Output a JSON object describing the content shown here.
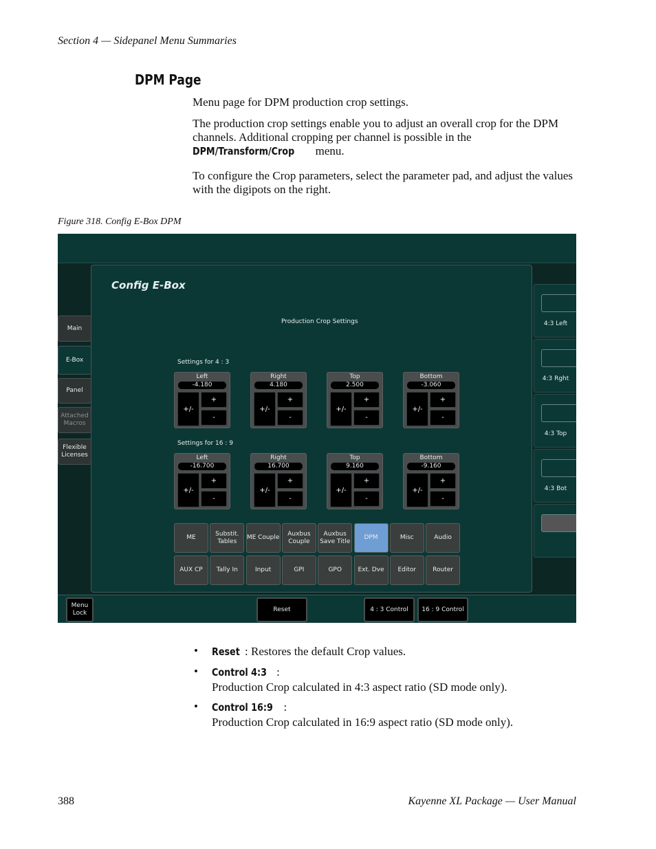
{
  "header": "Section 4 — Sidepanel Menu Summaries",
  "heading": "DPM Page",
  "para1": "Menu page for DPM production crop settings.",
  "para2a": "The production crop settings enable you to adjust an overall crop for the DPM channels. Additional cropping per channel is possible in the ",
  "para2b": "DPM/Transform/Crop",
  "para2c": " menu.",
  "para3": "To configure the Crop parameters, select the parameter pad, and adjust the values with the digipots on the right.",
  "caption": "Figure 318.  Config E-Box DPM",
  "ui": {
    "title": "Config E-Box",
    "section_title": "Production Crop Settings",
    "tabs": [
      {
        "label": "Main"
      },
      {
        "label": "E-Box",
        "selected": true
      },
      {
        "label": "Panel"
      },
      {
        "label": "Attached Macros",
        "disabled": true
      },
      {
        "label": "Flexible Licenses"
      }
    ],
    "knobs": [
      {
        "label": "4:3 Left"
      },
      {
        "label": "4:3 Rght"
      },
      {
        "label": "4:3 Top"
      },
      {
        "label": "4:3 Bot"
      },
      {
        "label": ""
      }
    ],
    "groups": [
      {
        "label": "Settings for 4 : 3",
        "pads": [
          {
            "name": "Left",
            "value": "-4.180"
          },
          {
            "name": "Right",
            "value": "4.180"
          },
          {
            "name": "Top",
            "value": "2.500"
          },
          {
            "name": "Bottom",
            "value": "-3.060"
          }
        ]
      },
      {
        "label": "Settings for 16 : 9",
        "pads": [
          {
            "name": "Left",
            "value": "-16.700"
          },
          {
            "name": "Right",
            "value": "16.700"
          },
          {
            "name": "Top",
            "value": "9.160"
          },
          {
            "name": "Bottom",
            "value": "-9.160"
          }
        ]
      }
    ],
    "pad_keys": {
      "toggle": "+/-",
      "plus": "+",
      "minus": "-"
    },
    "grid": [
      [
        "ME",
        "Substit. Tables",
        "ME Couple",
        "Auxbus Couple",
        "Auxbus Save Title",
        "DPM",
        "Misc",
        "Audio"
      ],
      [
        "AUX CP",
        "Tally In",
        "Input",
        "GPI",
        "GPO",
        "Ext. Dve",
        "Editor",
        "Router"
      ]
    ],
    "grid_selected": "DPM",
    "bottom": {
      "menu_lock": "Menu Lock",
      "reset": "Reset",
      "control43": "4 : 3 Control",
      "control169": "16 : 9 Control"
    },
    "colors": {
      "background": "#0b3835",
      "selected": "#6f9ed4"
    }
  },
  "bullets": [
    {
      "term": "Reset",
      "sep": ": ",
      "text": "Restores the default Crop values."
    },
    {
      "term": "Control 4:3",
      "sep": ":",
      "text": "Production Crop calculated in 4:3 aspect ratio (SD mode only)."
    },
    {
      "term": "Control 16:9",
      "sep": ":",
      "text": "Production Crop calculated in 16:9 aspect ratio (SD mode only)."
    }
  ],
  "footer": {
    "page": "388",
    "title": "Kayenne XL Package  —  User Manual"
  }
}
